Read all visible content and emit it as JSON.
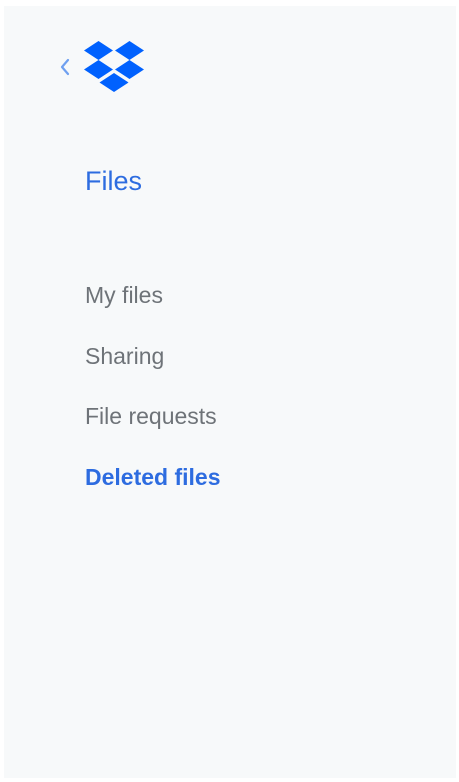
{
  "colors": {
    "accent": "#2d6ce0",
    "logo": "#0061fe",
    "nav_text": "#6e7378",
    "sidebar_bg": "#f7f9fa"
  },
  "header": {
    "back_icon": "chevron-left-icon",
    "logo_icon": "dropbox-logo-icon"
  },
  "section": {
    "title": "Files"
  },
  "nav": {
    "items": [
      {
        "label": "My files",
        "active": false
      },
      {
        "label": "Sharing",
        "active": false
      },
      {
        "label": "File requests",
        "active": false
      },
      {
        "label": "Deleted files",
        "active": true
      }
    ]
  }
}
